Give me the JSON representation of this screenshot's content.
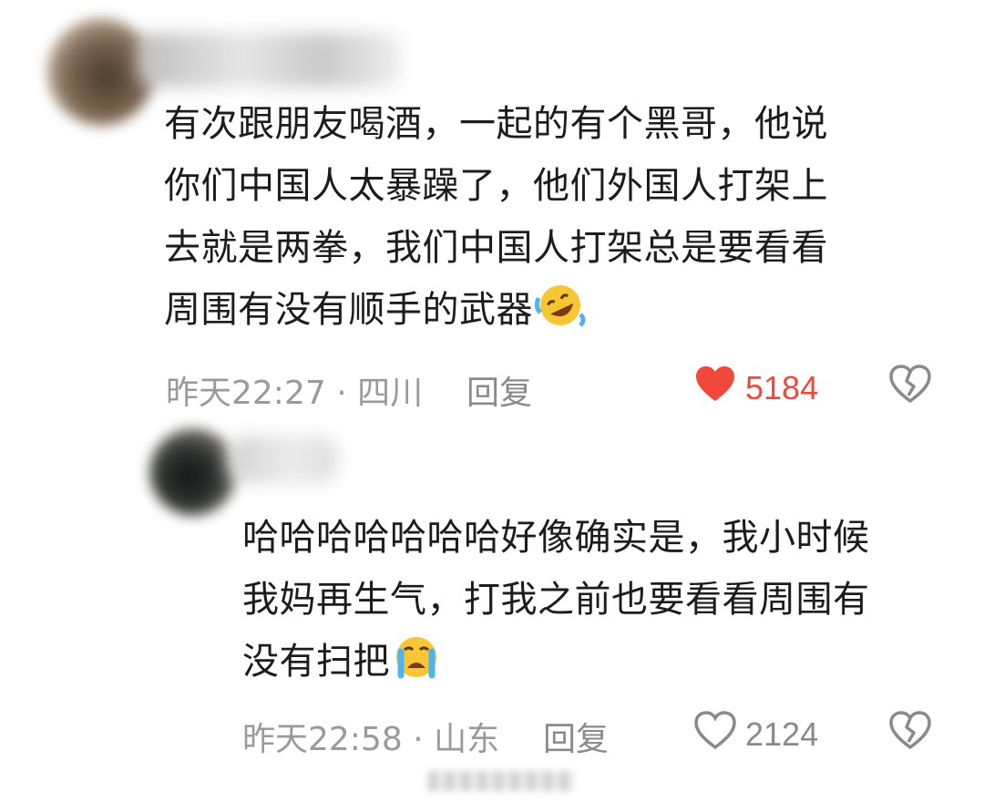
{
  "comments": [
    {
      "lines": [
        "有次跟朋友喝酒，一起的有个黑哥，他说",
        "你们中国人太暴躁了，他们外国人打架上",
        "去就是两拳，我们中国人打架总是要看看",
        "周围有没有顺手的武器"
      ],
      "emoji": "rolling-on-floor-laughing-emoji",
      "time_location": "昨天22:27 · 四川",
      "reply_label": "回复",
      "likes": "5184",
      "liked": true,
      "like_color": "#f0483a"
    },
    {
      "lines": [
        "哈哈哈哈哈哈哈好像确实是，我小时候",
        "我妈再生气，打我之前也要看看周围有",
        "没有扫把"
      ],
      "emoji": "loudly-crying-emoji",
      "time_location": "昨天22:58 · 山东",
      "reply_label": "回复",
      "likes": "2124",
      "liked": false
    }
  ]
}
